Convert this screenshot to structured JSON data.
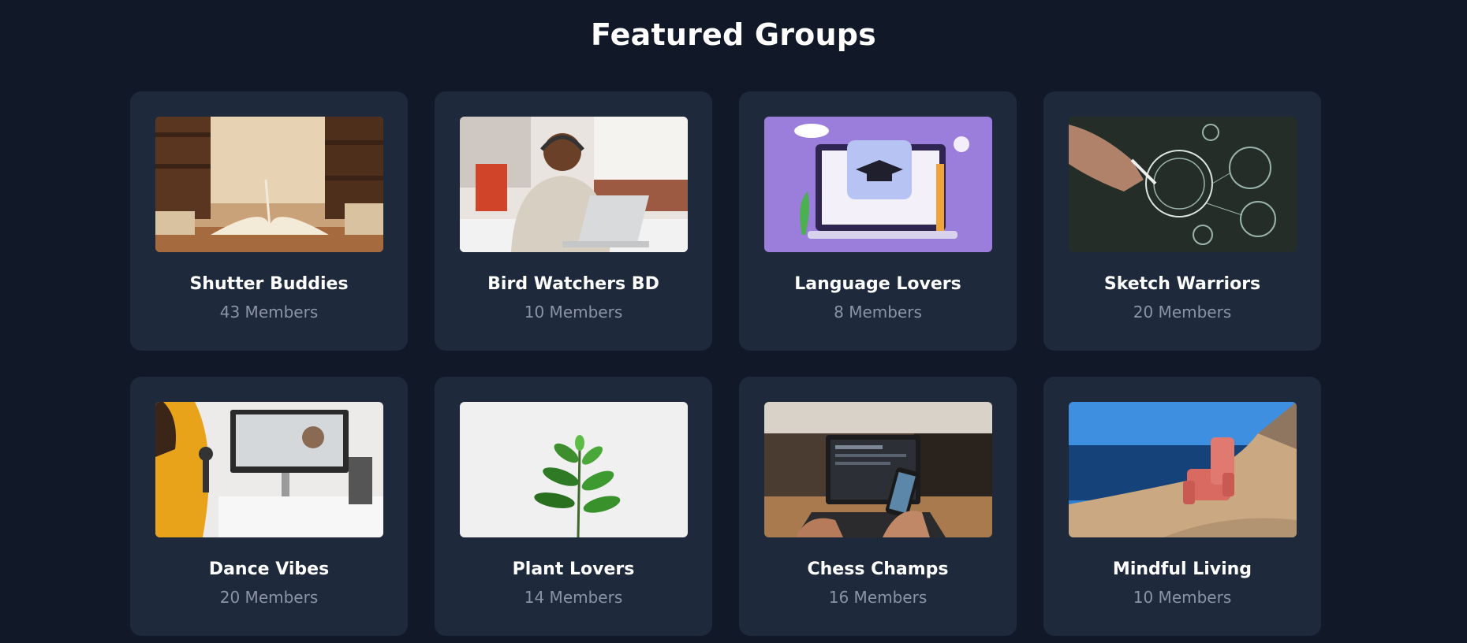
{
  "section": {
    "title": "Featured Groups"
  },
  "groups": [
    {
      "name": "Shutter Buddies",
      "members": "43 Members",
      "image": "books-library"
    },
    {
      "name": "Bird Watchers BD",
      "members": "10 Members",
      "image": "man-laptop-headphones"
    },
    {
      "name": "Language Lovers",
      "members": "8 Members",
      "image": "graduation-laptop-illustration"
    },
    {
      "name": "Sketch Warriors",
      "members": "20 Members",
      "image": "training-diagram"
    },
    {
      "name": "Dance Vibes",
      "members": "20 Members",
      "image": "woman-video-call"
    },
    {
      "name": "Plant Lovers",
      "members": "14 Members",
      "image": "green-plant"
    },
    {
      "name": "Chess Champs",
      "members": "16 Members",
      "image": "laptop-phone-cafe"
    },
    {
      "name": "Mindful Living",
      "members": "10 Members",
      "image": "chair-on-seaside-rock"
    }
  ],
  "colors": {
    "background": "#111827",
    "card": "#1e293b",
    "muted_text": "#8a94a6"
  }
}
